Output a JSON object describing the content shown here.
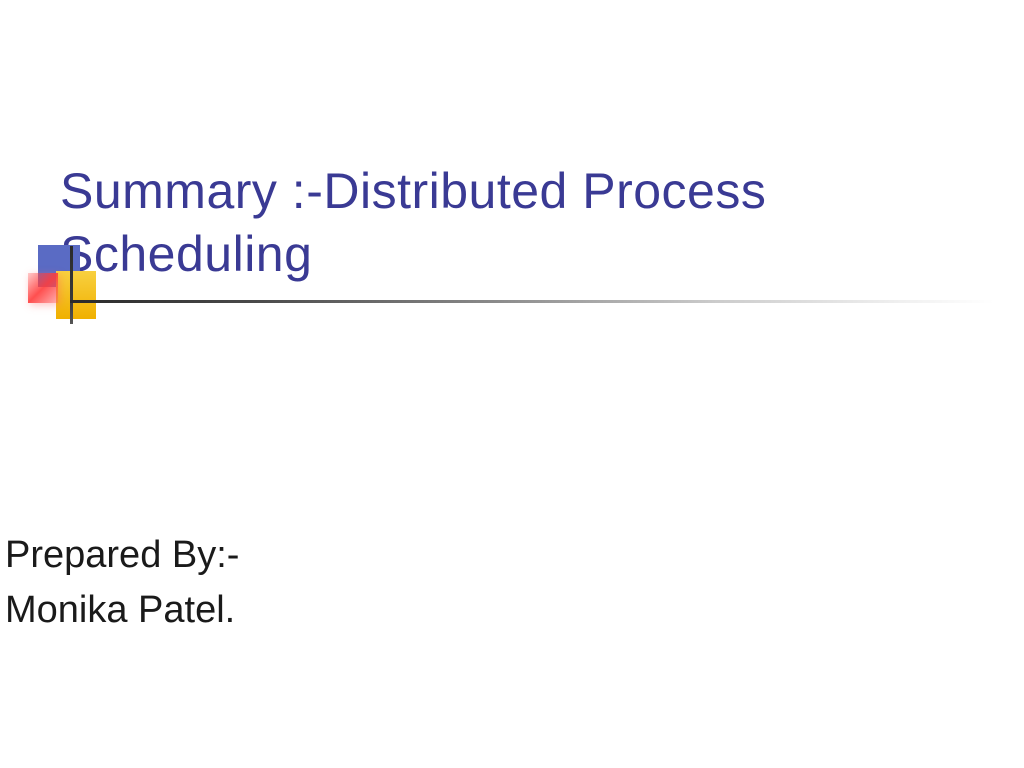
{
  "slide": {
    "title": "Summary :-Distributed Process Scheduling",
    "prepared_by_label": "Prepared By:-",
    "author_name": "Monika Patel."
  },
  "colors": {
    "title_color": "#3a3a94",
    "body_text_color": "#1a1a1a",
    "accent_blue": "#5a6bc4",
    "accent_red": "#ff5050",
    "accent_yellow": "#f8d040"
  }
}
